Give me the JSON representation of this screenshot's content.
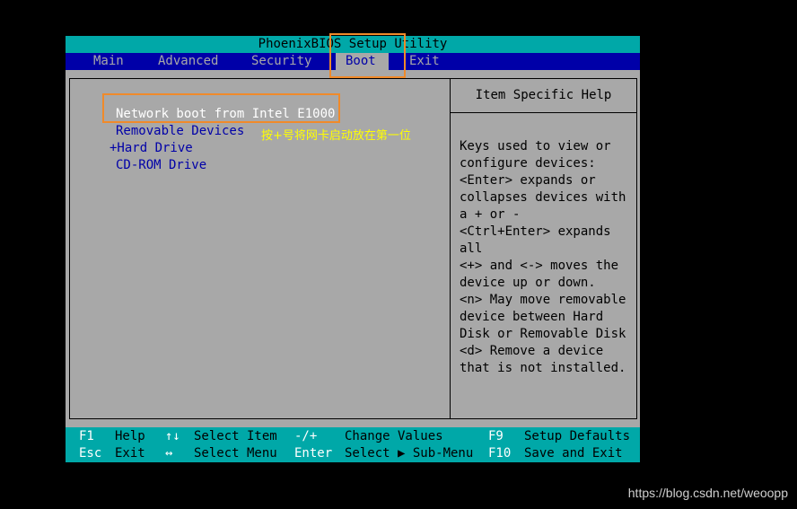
{
  "colors": {
    "cyan": "#00a8a8",
    "blue": "#0000a8",
    "gray": "#a8a8a8",
    "highlight": "#f08a2a",
    "annotation": "#ffff00"
  },
  "title": "PhoenixBIOS Setup Utility",
  "menu": [
    "Main",
    "Advanced",
    "Security",
    "Boot",
    "Exit"
  ],
  "active_menu": "Boot",
  "boot_order": [
    "Network boot from Intel E1000",
    "Removable Devices",
    "+Hard Drive",
    "CD-ROM Drive"
  ],
  "annotation": "按+号将网卡启动放在第一位",
  "help": {
    "title": "Item Specific Help",
    "text": "Keys used to view or\nconfigure devices:\n<Enter> expands or\ncollapses devices with\na + or -\n<Ctrl+Enter> expands\nall\n<+> and <-> moves the\ndevice up or down.\n<n> May move removable\ndevice between Hard\nDisk or Removable Disk\n<d> Remove a device\nthat is not installed."
  },
  "status": {
    "f1": "F1",
    "help": "Help",
    "arrows_ud": "↑↓",
    "select_item": "Select Item",
    "minus_plus": "-/+",
    "change_values": "Change Values",
    "f9": "F9",
    "setup_defaults": "Setup Defaults",
    "esc": "Esc",
    "exit": "Exit",
    "arrows_lr": "↔",
    "select_menu": "Select Menu",
    "enter": "Enter",
    "select_submenu": "Select ▶ Sub-Menu",
    "f10": "F10",
    "save_exit": "Save and Exit"
  },
  "watermark": "https://blog.csdn.net/weoopp"
}
